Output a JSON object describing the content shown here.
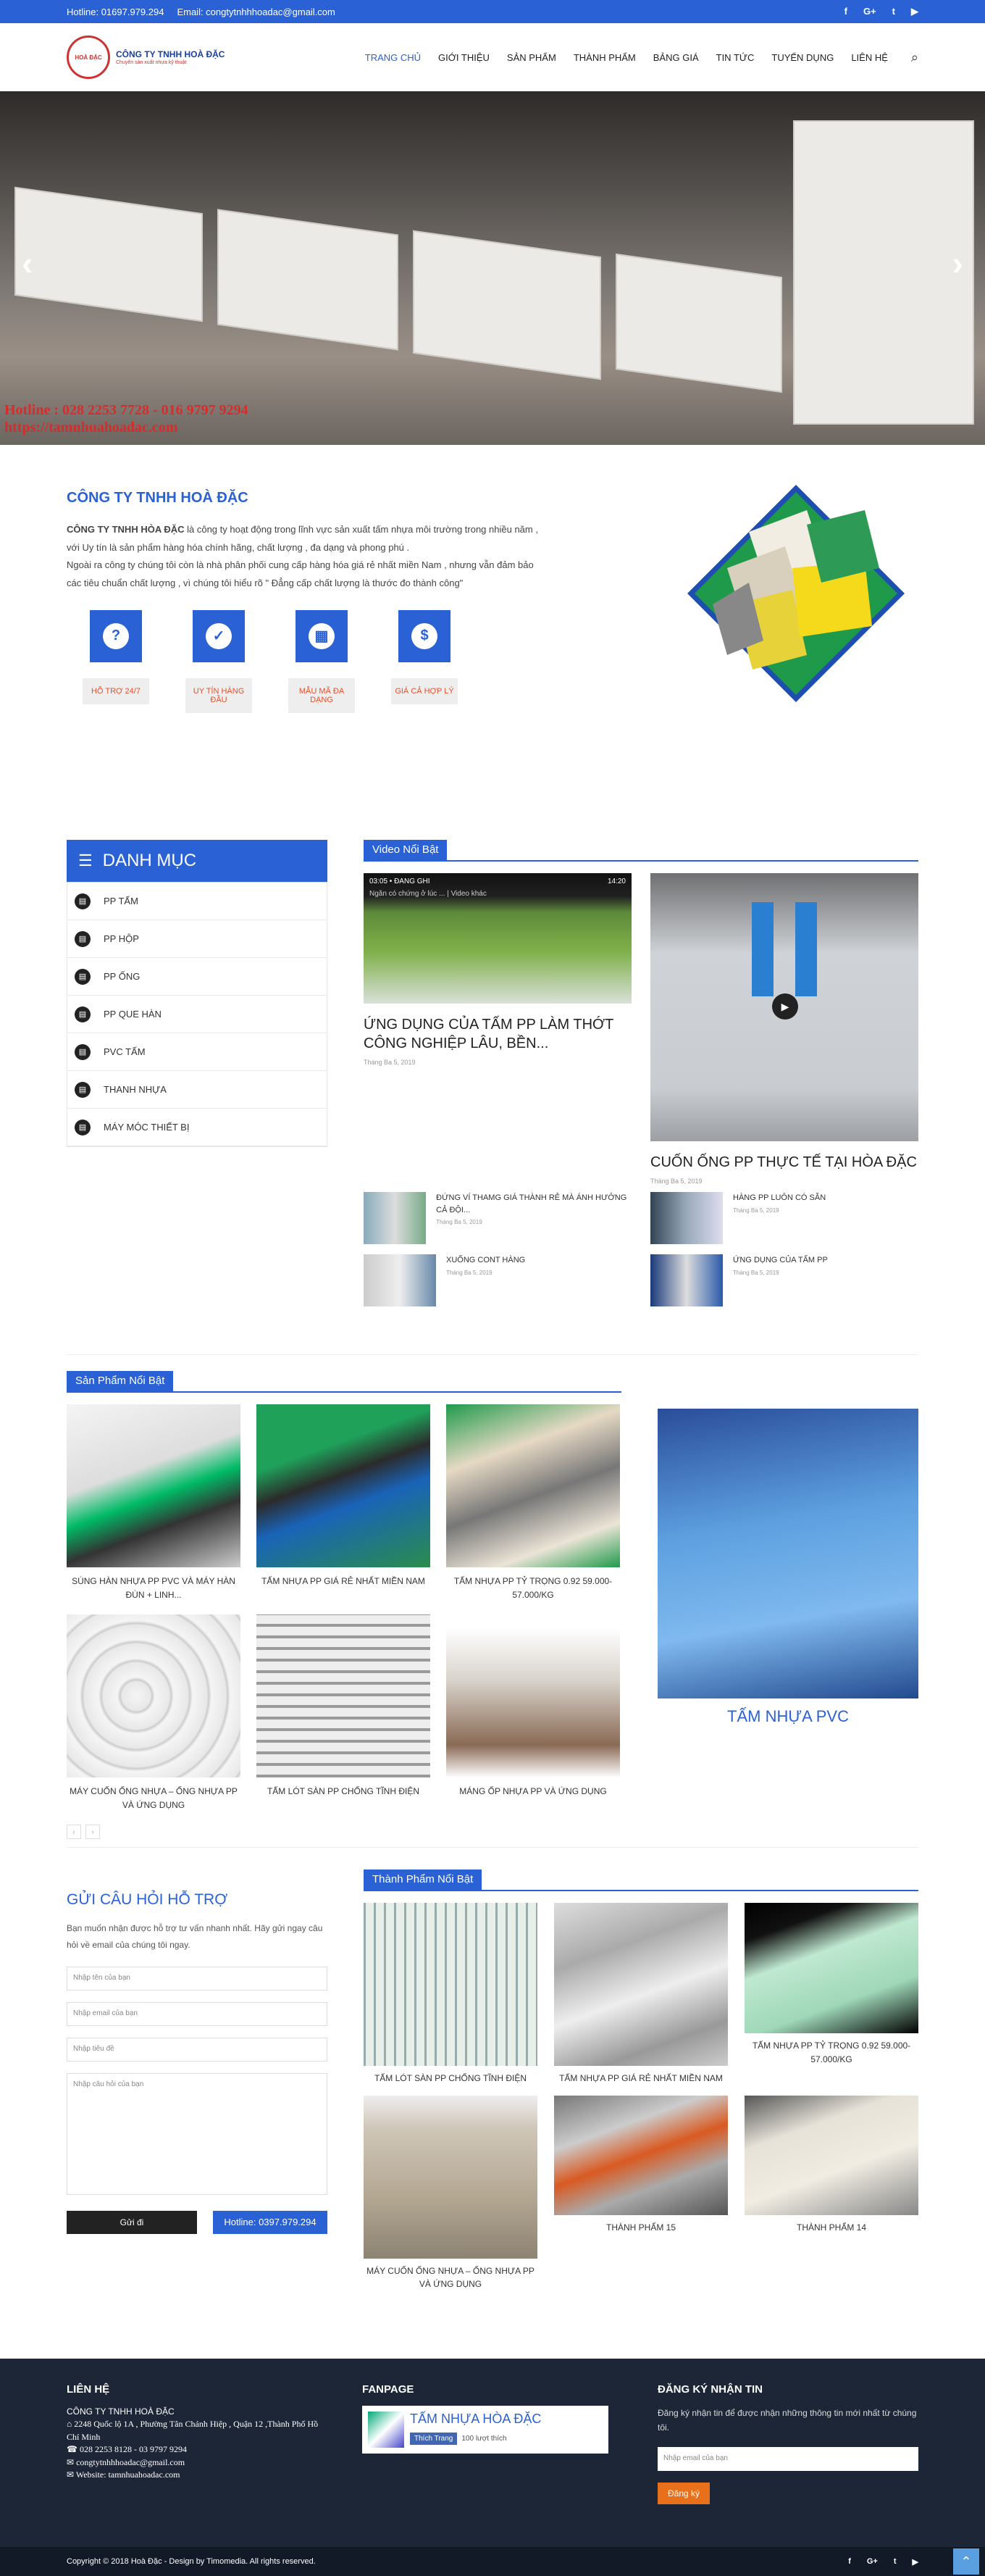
{
  "topbar": {
    "hotline": "Hotline: 01697.979.294",
    "email": "Email: congtytnhhhoadac@gmail.com",
    "social": [
      "f",
      "G+",
      "t",
      "▶"
    ]
  },
  "header": {
    "logo_title": "CÔNG TY TNHH HOÀ ĐẶC",
    "logo_sub": "Chuyên sản xuất nhựa kỹ thuật",
    "nav": [
      "TRANG CHỦ",
      "GIỚI THIỆU",
      "SẢN PHẨM",
      "THÀNH PHẨM",
      "BẢNG GIÁ",
      "TIN TỨC",
      "TUYỂN DỤNG",
      "LIÊN HỆ"
    ]
  },
  "banner": {
    "line1": "Hotline : 028 2253 7728 - 016 9797 9294",
    "line2": "https://tamnhuahoadac.com"
  },
  "about": {
    "title": "CÔNG TY  TNHH HOÀ ĐẶC",
    "p1_bold": "CÔNG TY TNHH HÒA ĐẶC",
    "p1": " là công ty hoạt động trong lĩnh vực sản xuất tấm nhựa môi trường trong nhiều năm , với Uy tín là sản phẩm hàng hóa chính hãng, chất lượng , đa dạng và phong phú .",
    "p2": "Ngoài ra công ty chúng tôi còn là nhà phân phối cung cấp hàng hóa giá rẻ nhất miền Nam , nhưng vẫn đảm bảo các tiêu chuẩn chất lượng , vì chúng tôi hiểu rõ \" Đẳng cấp chất lượng là thước đo thành công\"",
    "features": [
      {
        "icon": "?",
        "label": "HỖ TRỢ 24/7"
      },
      {
        "icon": "✓",
        "label": "UY TÍN HÀNG ĐẦU"
      },
      {
        "icon": "▦",
        "label": "MẪU MÃ ĐA DẠNG"
      },
      {
        "icon": "$",
        "label": "GIÁ CẢ HỢP LÝ"
      }
    ]
  },
  "danhmuc": {
    "title": "DANH MỤC",
    "items": [
      "PP TẤM",
      "PP HỘP",
      "PP ỐNG",
      "PP QUE HÀN",
      "PVC TẤM",
      "THANH NHỰA",
      "MÁY MÓC THIẾT BỊ"
    ]
  },
  "video": {
    "title": "Video Nổi Bật",
    "main": [
      {
        "title": "ỨNG DỤNG CỦA TẤM PP LÀM THỚT CÔNG NGHIỆP LÂU, BỀN...",
        "date": "Tháng Ba 5, 2019",
        "overlay_time": "03:05 • ĐANG GHI",
        "overlay_clock": "14:20",
        "overlay_sub": "Ngăn có chứng ở lúc ... | Video khác"
      },
      {
        "title": "CUỐN ỐNG PP THỰC TẾ TẠI HÒA ĐẶC",
        "date": "Tháng Ba 5, 2019"
      }
    ],
    "small": [
      {
        "title": "ĐỨNG VÍ THAMG GIÁ THÀNH RẺ MÀ ÁNH HƯỞNG CẢ ĐỘI...",
        "date": "Tháng Ba 5, 2019"
      },
      {
        "title": "HÀNG PP LUÔN CÓ SẴN",
        "date": "Tháng Ba 5, 2019"
      },
      {
        "title": "XUỐNG CONT HÀNG",
        "date": "Tháng Ba 5, 2019"
      },
      {
        "title": "ỨNG DỤNG CỦA TẤM PP",
        "date": "Tháng Ba 5, 2019"
      }
    ]
  },
  "products": {
    "title": "Sản Phẩm Nổi Bật",
    "items": [
      "SÚNG HÀN NHỰA PP PVC VÀ MÁY HÀN ĐÙN + LINH...",
      "TẤM NHỰA PP GIÁ RẺ NHẤT MIỀN NAM",
      "TẤM NHỰA PP TỶ TRỌNG 0.92 59.000-57.000/KG",
      "MÁY CUỐN ỐNG NHỰA – ỐNG NHỰA PP VÀ ỨNG DỤNG",
      "TẤM LÓT SÀN PP CHỐNG TĨNH ĐIỆN",
      "MÁNG ỐP NHỰA PP VÀ ỨNG DỤNG"
    ],
    "big": "TẤM NHỰA PVC",
    "prev": "‹",
    "next": "›"
  },
  "form": {
    "title": "GỬI CÂU HỎI HỖ TRỢ",
    "desc": "Bạn muốn nhận được hỗ trợ tư vấn nhanh nhất. Hãy gửi ngay câu hỏi về email của chúng tôi ngay.",
    "name_ph": "Nhập tên của bạn",
    "email_ph": "Nhập email của bạn",
    "subject_ph": "Nhập tiêu đề",
    "question_ph": "Nhập câu hỏi của bạn",
    "submit": "Gửi đi",
    "hotline": "Hotline: 0397.979.294"
  },
  "thanhpham": {
    "title": "Thành Phẩm Nổi Bật",
    "items": [
      "TẤM LÓT SÀN PP CHỐNG TĨNH ĐIỆN",
      "TẤM NHỰA PP GIÁ RẺ NHẤT MIỀN NAM",
      "TẤM NHỰA PP TỶ TRỌNG 0.92 59.000-57.000/KG",
      "MÁY CUỐN ỐNG NHỰA – ỐNG NHỰA PP VÀ ỨNG DỤNG",
      "THÀNH PHẨM 15",
      "THÀNH PHẨM 14"
    ]
  },
  "footer": {
    "contact_title": "LIÊN HỆ",
    "company": "CÔNG TY TNHH HOÀ ĐẶC",
    "address": "2248 Quốc lộ 1A , Phường Tân Chánh Hiệp , Quận 12 ,Thành Phố Hồ Chí Minh",
    "phone": "028 2253 8128 - 03 9797 9294",
    "email": "congtytnhhhoadac@gmail.com",
    "website": "Website: tamnhuahoadac.com",
    "fanpage_title": "FANPAGE",
    "fanpage_name": "TẤM NHỰA HÒA ĐẶC",
    "fanpage_like": "Thích Trang",
    "fanpage_count": "100 lượt thích",
    "nl_title": "ĐĂNG KÝ NHẬN TIN",
    "nl_desc": "Đăng ký nhận tin để được nhận những thông tin mới nhất từ chúng tôi.",
    "nl_ph": "Nhập email của bạn",
    "nl_btn": "Đăng ký",
    "copyright": "Copyright © 2018 Hoà Đặc - Design by Timomedia. All rights reserved.",
    "up": "⌃"
  },
  "colors": {
    "primary": "#2a62d6",
    "accent": "#e8701a",
    "footer": "#1c2637"
  }
}
